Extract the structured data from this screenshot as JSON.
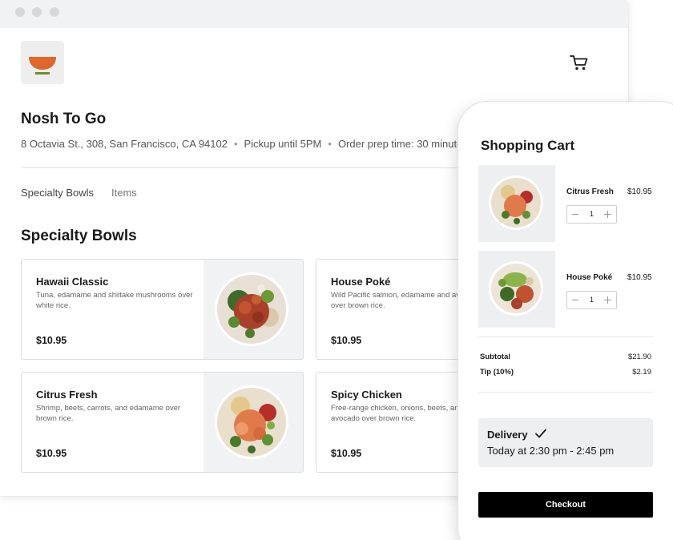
{
  "store": {
    "name": "Nosh To Go",
    "address": "8 Octavia St., 308, San Francisco, CA 94102",
    "pickup": "Pickup until 5PM",
    "prep_time": "Order prep time: 30 minutes",
    "separator": "•"
  },
  "icons": {
    "logo": "bowl-logo-icon",
    "cart": "shopping-cart-icon",
    "check": "checkmark-icon"
  },
  "colors": {
    "logo_bowl": "#e0662c",
    "logo_base": "#6a8e2c",
    "checkout_bg": "#000000",
    "panel_bg": "#f1f2f4"
  },
  "tabs": [
    {
      "label": "Specialty Bowls"
    },
    {
      "label": "Items"
    }
  ],
  "menu": {
    "section_title": "Specialty Bowls",
    "items": [
      {
        "name": "Hawaii Classic",
        "description": "Tuna, edamame and shiitake mushrooms over white rice.",
        "price": "$10.95"
      },
      {
        "name": "House Poké",
        "description": "Wild Pacific salmon, edamame and avocado over brown rice.",
        "price": "$10.95"
      },
      {
        "name": "Citrus Fresh",
        "description": "Shrimp, beets, carrots, and edamame over brown rice.",
        "price": "$10.95"
      },
      {
        "name": "Spicy Chicken",
        "description": "Free-range chicken, onions, beets, and avocado over brown rice.",
        "price": "$10.95"
      }
    ]
  },
  "cart": {
    "title": "Shopping Cart",
    "items": [
      {
        "name": "Citrus Fresh",
        "price": "$10.95",
        "qty": "1"
      },
      {
        "name": "House Poké",
        "price": "$10.95",
        "qty": "1"
      }
    ],
    "subtotal_label": "Subtotal",
    "subtotal": "$21.90",
    "tip_label": "Tip (10%)",
    "tip": "$2.19",
    "delivery_label": "Delivery",
    "delivery_time": "Today at 2:30 pm - 2:45 pm",
    "checkout_label": "Checkout"
  }
}
